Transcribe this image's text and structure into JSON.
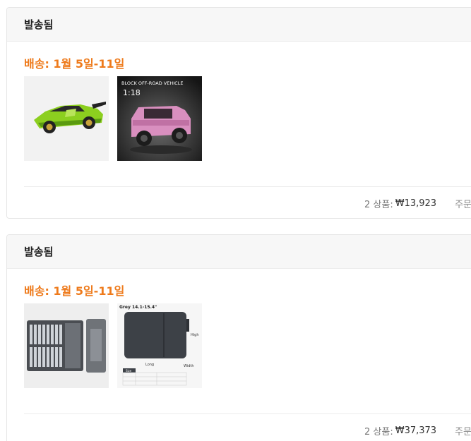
{
  "orders": [
    {
      "status": "발송됨",
      "delivery": "배송: 1월 5일-11일",
      "items": [
        {
          "name": "green-sports-car-block-set"
        },
        {
          "name": "pink-offroad-vehicle-block-set",
          "badge_top": "BLOCK OFF-ROAD VEHICLE",
          "badge_scale": "1:18"
        }
      ],
      "count_label": "2 상품:",
      "price": "₩13,923",
      "action": "주문"
    },
    {
      "status": "발송됨",
      "delivery": "배송: 1월 5일-11일",
      "items": [
        {
          "name": "screwdriver-bit-set"
        },
        {
          "name": "laptop-sleeve-bag",
          "title": "Grey 14.1-15.4\"",
          "label_high": "High",
          "label_long": "Long",
          "label_width": "Width",
          "table_header": "Size"
        }
      ],
      "count_label": "2 상품:",
      "price": "₩37,373",
      "action": "주문"
    }
  ],
  "colors": {
    "accent": "#ee7a1b",
    "header_bg": "#f7f7f7",
    "border": "#e6e6e6"
  }
}
